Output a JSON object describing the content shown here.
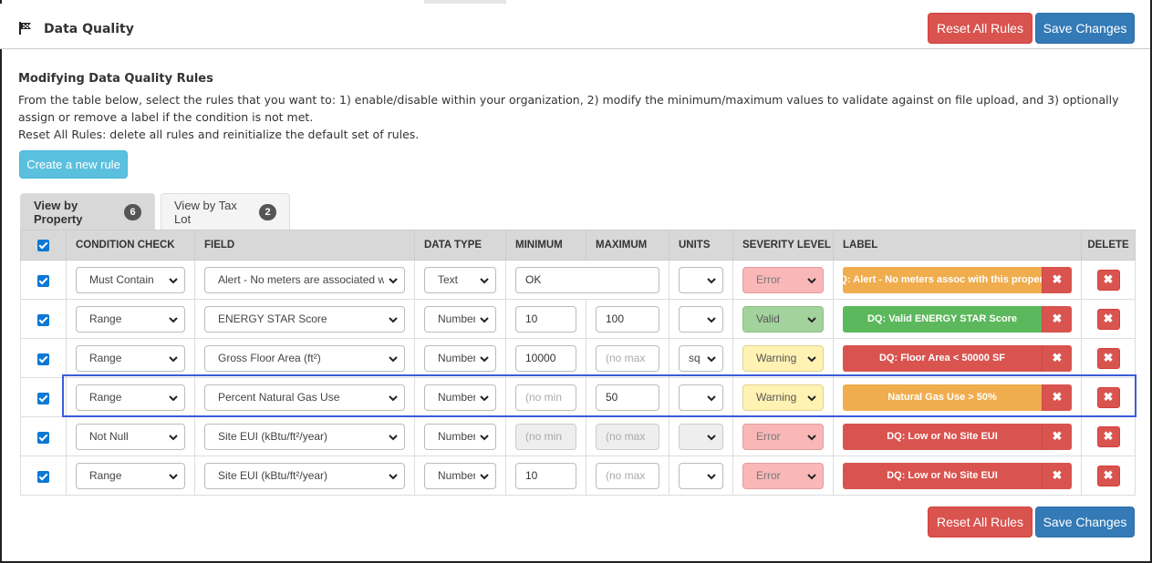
{
  "header": {
    "title": "Data Quality",
    "reset_label": "Reset All Rules",
    "save_label": "Save Changes"
  },
  "intro": {
    "heading": "Modifying Data Quality Rules",
    "description": "From the table below, select the rules that you want to: 1) enable/disable within your organization, 2) modify the minimum/maximum values to validate against on file upload, and 3) optionally assign or remove a label if the condition is not met.",
    "reset_note": "Reset All Rules: delete all rules and reinitialize the default set of rules.",
    "create_label": "Create a new rule"
  },
  "tabs": [
    {
      "label": "View by Property",
      "count": "6"
    },
    {
      "label": "View by Tax Lot",
      "count": "2"
    }
  ],
  "table": {
    "headers": {
      "condition": "CONDITION CHECK",
      "field": "FIELD",
      "data_type": "DATA TYPE",
      "minimum": "MINIMUM",
      "maximum": "MAXIMUM",
      "units": "UNITS",
      "severity": "SEVERITY LEVEL",
      "label": "LABEL",
      "delete": "DELETE"
    },
    "rows": [
      {
        "condition": "Must Contain",
        "field": "Alert - No meters are associated with this property",
        "data_type": "Text",
        "minimum": "OK",
        "maximum": "",
        "units": "",
        "severity": "Error",
        "label": "DQ: Alert - No meters assoc with this property"
      },
      {
        "condition": "Range",
        "field": "ENERGY STAR Score",
        "data_type": "Number",
        "minimum": "10",
        "maximum": "100",
        "units": "",
        "severity": "Valid",
        "label": "DQ: Valid ENERGY STAR Score"
      },
      {
        "condition": "Range",
        "field": "Gross Floor Area (ft²)",
        "data_type": "Number",
        "minimum": "10000",
        "maximum": "",
        "maximum_placeholder": "(no max",
        "units": "sq",
        "severity": "Warning",
        "label": "DQ: Floor Area < 50000 SF"
      },
      {
        "condition": "Range",
        "field": "Percent Natural Gas Use",
        "data_type": "Number",
        "minimum": "",
        "minimum_placeholder": "(no min",
        "maximum": "50",
        "units": "",
        "severity": "Warning",
        "label": "Natural Gas Use > 50%"
      },
      {
        "condition": "Not Null",
        "field": "Site EUI (kBtu/ft²/year)",
        "data_type": "Number",
        "minimum": "",
        "minimum_placeholder": "(no min",
        "maximum": "",
        "maximum_placeholder": "(no max",
        "units": "",
        "severity": "Error",
        "label": "DQ: Low or No Site EUI"
      },
      {
        "condition": "Range",
        "field": "Site EUI (kBtu/ft²/year)",
        "data_type": "Number",
        "minimum": "10",
        "maximum": "",
        "maximum_placeholder": "(no max",
        "units": "",
        "severity": "Error",
        "label": "DQ: Low or No Site EUI"
      }
    ]
  },
  "colors": {
    "label_orange": "#f0ad4e",
    "label_green": "#5cb85c",
    "label_red": "#d9534f",
    "primary": "#337ab7",
    "danger": "#d9534f",
    "info": "#5bc0de",
    "highlight": "#3b5bdb"
  },
  "icons": {
    "header": "flag-icon",
    "select": "chevron-down-icon",
    "remove": "close-icon",
    "checkbox": "checkmark-icon"
  }
}
